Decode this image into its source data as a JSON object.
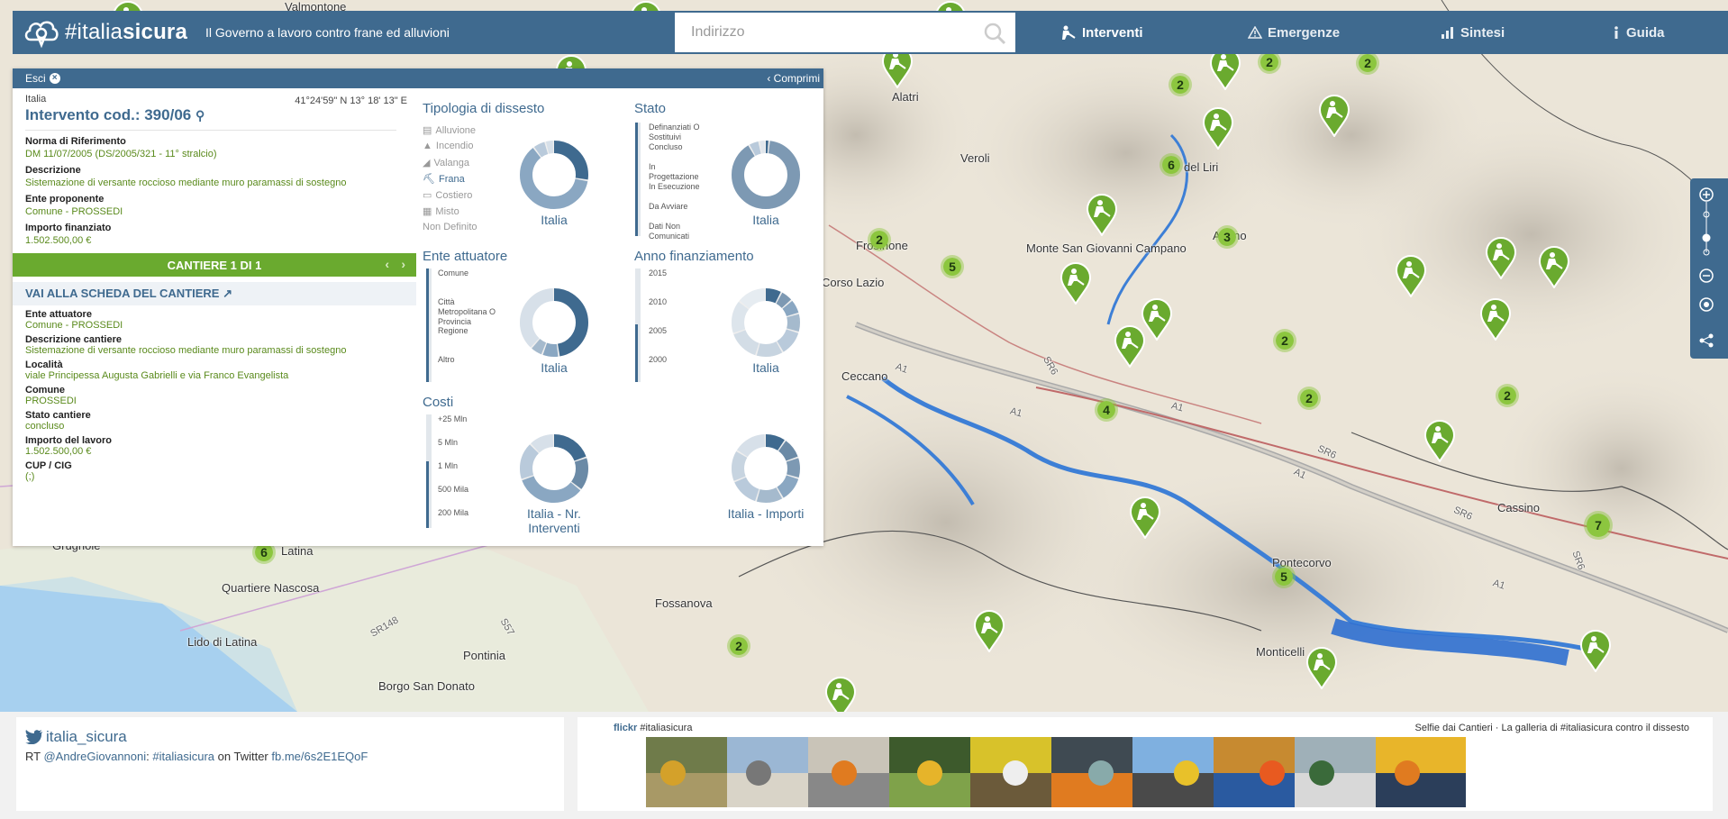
{
  "header": {
    "brand_prefix": "#italia",
    "brand_suffix": "sicura",
    "tagline": "Il Governo a lavoro contro frane ed alluvioni",
    "search_placeholder": "Indirizzo",
    "nav": [
      {
        "label": "Interventi",
        "icon": "worker-icon",
        "active": true
      },
      {
        "label": "Emergenze",
        "icon": "warning-icon",
        "active": false
      },
      {
        "label": "Sintesi",
        "icon": "bar-chart-icon",
        "active": false
      },
      {
        "label": "Guida",
        "icon": "info-icon",
        "active": false
      }
    ],
    "accent_color": "#3f6a8f"
  },
  "map": {
    "places": [
      "Valmontone",
      "Alatri",
      "Veroli",
      "Frosinone",
      "Corso Lazio",
      "Monte San Giovanni Campano",
      "del Liri",
      "Arpino",
      "Ceccano",
      "Latina",
      "Quartiere Nascosa",
      "Lido di Latina",
      "Pontinia",
      "Borgo San Donato",
      "Fossanova",
      "Pontecorvo",
      "Monticelli",
      "Cassino",
      "Grugnole"
    ],
    "roads": [
      "A1",
      "A1",
      "A1",
      "A1",
      "A1",
      "SR6",
      "SR6",
      "SR6",
      "SR6",
      "SR148",
      "S57",
      "SR6"
    ],
    "clusters": [
      "2",
      "2",
      "2",
      "6",
      "2",
      "3",
      "5",
      "2",
      "2",
      "4",
      "2",
      "7",
      "6",
      "5",
      "2"
    ],
    "pin_count": 22,
    "pin_color": "#6aaa2f",
    "cluster_color": "#8cc63f"
  },
  "panel": {
    "exit_label": "Esci",
    "collapse_label": "Comprimi",
    "country": "Italia",
    "coords": "41°24'59\" N 13° 18' 13\" E",
    "code": "Intervento cod.: 390/06",
    "fields": [
      {
        "label": "Norma di Riferimento",
        "value": "DM 11/07/2005 (DS/2005/321 - 11° stralcio)"
      },
      {
        "label": "Descrizione",
        "value": "Sistemazione di versante roccioso mediante muro paramassi di sostegno"
      },
      {
        "label": "Ente proponente",
        "value": "Comune - PROSSEDI"
      },
      {
        "label": "Importo finanziato",
        "value": "1.502.500,00 €"
      }
    ],
    "cantiere_label": "CANTIERE 1 DI 1",
    "scheda_label": "VAI ALLA SCHEDA DEL CANTIERE",
    "cantiere_fields": [
      {
        "label": "Ente attuatore",
        "value": "Comune - PROSSEDI"
      },
      {
        "label": "Descrizione cantiere",
        "value": "Sistemazione di versante roccioso mediante muro paramassi di sostegno"
      },
      {
        "label": "Località",
        "value": "viale Principessa Augusta Gabrielli e via Franco Evangelista"
      },
      {
        "label": "Comune",
        "value": "PROSSEDI"
      },
      {
        "label": "Stato cantiere",
        "value": "concluso"
      },
      {
        "label": "Importo del lavoro",
        "value": "1.502.500,00 €"
      },
      {
        "label": "CUP / CIG",
        "value": "(;)"
      }
    ]
  },
  "stats": {
    "tipologia": {
      "title": "Tipologia di dissesto",
      "items": [
        "Alluvione",
        "Incendio",
        "Valanga",
        "Frana",
        "Costiero",
        "Misto",
        "Non Definito"
      ],
      "selected": "Frana",
      "donut_label": "Italia"
    },
    "stato": {
      "title": "Stato",
      "items": [
        "Definanziati O Sostituivi",
        "Concluso",
        "In Progettazione",
        "In Esecuzione",
        "Da Avviare",
        "Dati Non Comunicati"
      ],
      "selected": "Concluso",
      "donut_label": "Italia"
    },
    "ente": {
      "title": "Ente attuatore",
      "items": [
        "Comune",
        "Città Metropolitana O Provincia",
        "Regione",
        "Altro"
      ],
      "donut_label": "Italia"
    },
    "anno": {
      "title": "Anno finanziamento",
      "items": [
        "2015",
        "2010",
        "2005",
        "2000"
      ],
      "selected": "2005",
      "donut_label": "Italia"
    },
    "costi": {
      "title": "Costi",
      "items": [
        "+25 Mln",
        "5 Mln",
        "1 Mln",
        "500 Mila",
        "200 Mila"
      ],
      "selected": "1 Mln",
      "donut_label_left": "Italia - Nr. Interventi",
      "donut_label_right": "Italia - Importi"
    }
  },
  "twitter": {
    "handle": "italia_sicura",
    "rt_prefix": "RT ",
    "mention": "@AndreGiovannoni",
    "colon": ": ",
    "hashtag": "#italiasicura",
    "middle": " on Twitter ",
    "link": "fb.me/6s2E1EQoF"
  },
  "flickr": {
    "brand": "flickr",
    "hashtag": "#italiasicura",
    "caption": "Selfie dai Cantieri · La galleria di #italiasicura contro il dissesto",
    "photo_count": 10
  }
}
